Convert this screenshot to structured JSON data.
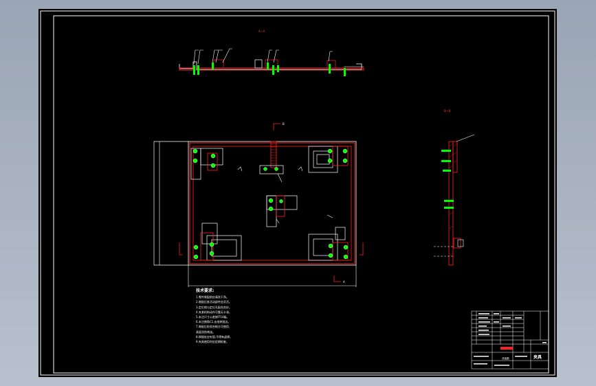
{
  "drawing": {
    "section_label_top": "A—A",
    "section_label_right": "B—B",
    "section_mark_b": "B",
    "section_mark_a": "A",
    "notes_title": "技术要求:",
    "notes": [
      "1.零件装配前应清洗干净。",
      "2.装配后各活动部件应灵活。",
      "3.定位销与定位孔配合良好。",
      "4.夹紧机构动作可靠无卡滞。",
      "5.未注尺寸公差按IT14级。",
      "6.未注倒角C1,去毛刺锐边。",
      "7.装配后检验合格方可使用,",
      "  表面涂防锈油。",
      "8.焊接处应牢固,不得有虚焊。",
      "9.夹具使用时应定期检查。"
    ],
    "title_block": {
      "part_name": "夹具",
      "drawing_name": "总装图"
    }
  },
  "colors": {
    "workspace": "#000000",
    "frame": "#ffffff",
    "outline": "#ff0000",
    "part": "#ffffff",
    "fastener": "#00ff00"
  }
}
